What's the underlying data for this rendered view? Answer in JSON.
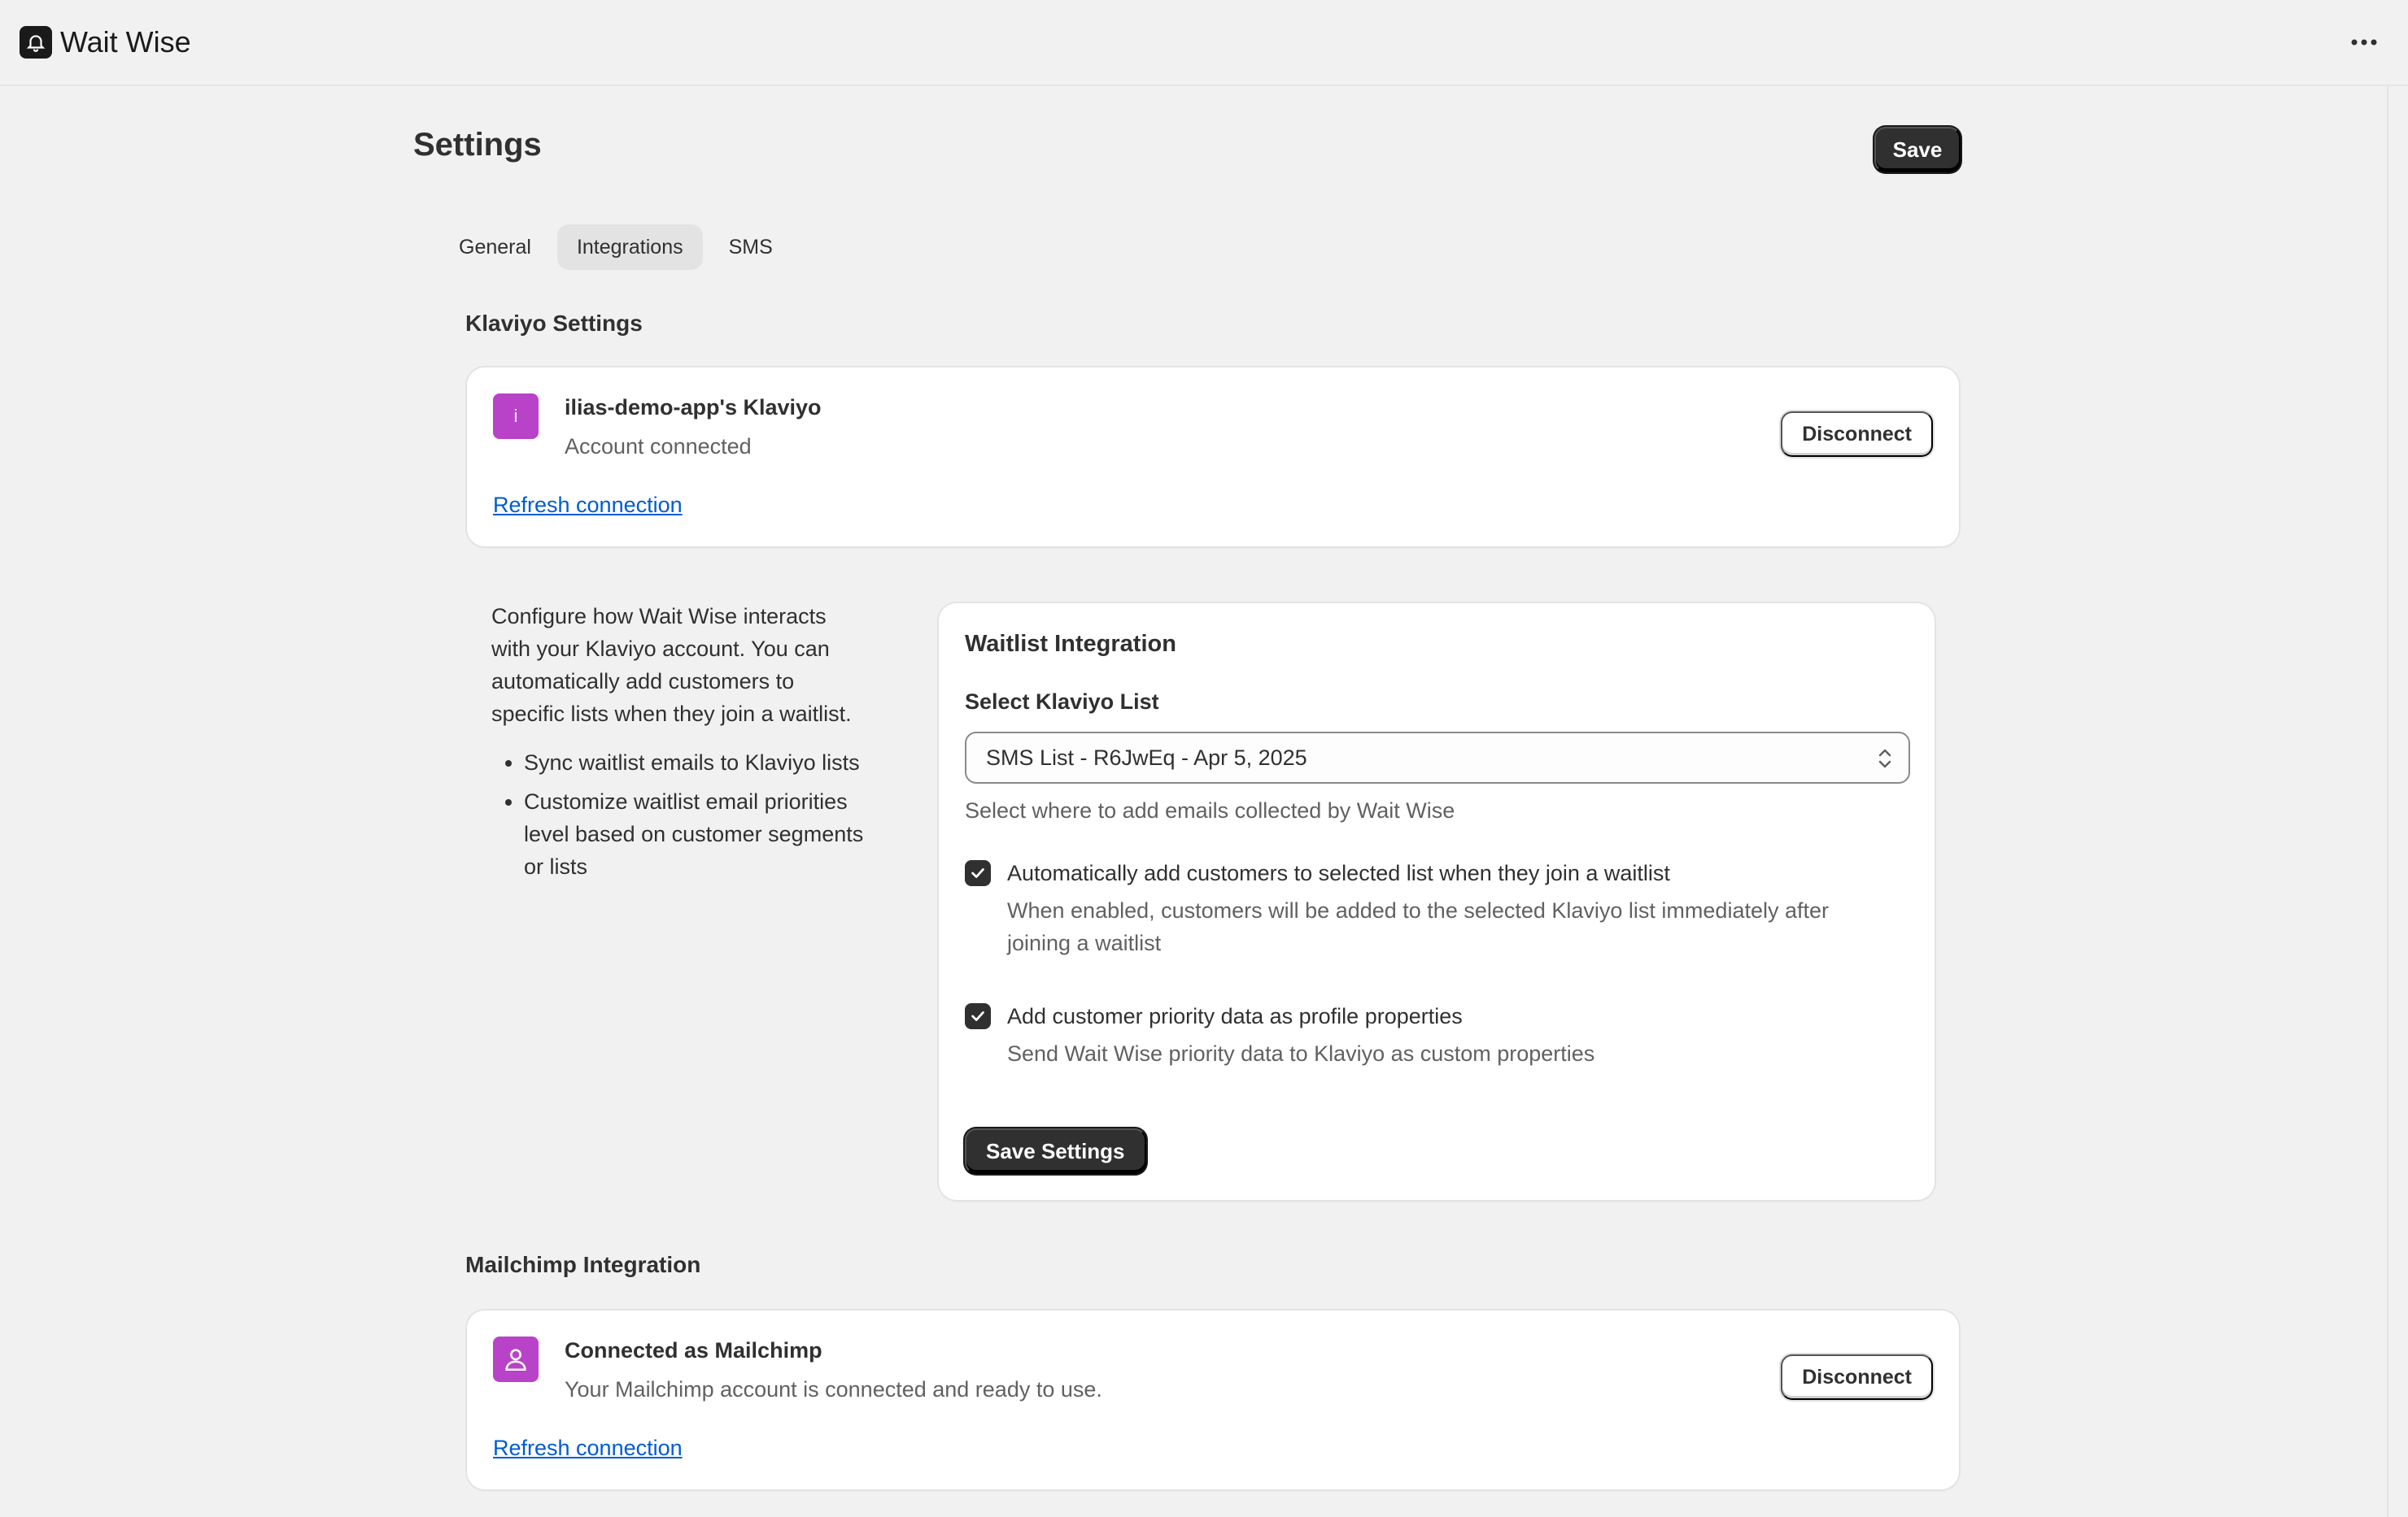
{
  "app": {
    "name": "Wait Wise",
    "logo_icon": "bell-icon",
    "menu_icon": "more-horizontal-icon"
  },
  "page": {
    "title": "Settings",
    "save_label": "Save"
  },
  "tabs": [
    {
      "label": "General",
      "active": false
    },
    {
      "label": "Integrations",
      "active": true
    },
    {
      "label": "SMS",
      "active": false
    }
  ],
  "klaviyo": {
    "section_title": "Klaviyo Settings",
    "avatar_letter": "i",
    "account_name": "ilias-demo-app's Klaviyo",
    "status": "Account connected",
    "disconnect_label": "Disconnect",
    "refresh_label": "Refresh connection"
  },
  "description": {
    "text": "Configure how Wait Wise interacts with your Klaviyo account. You can automatically add customers to specific lists when they join a waitlist.",
    "bullets": [
      "Sync waitlist emails to Klaviyo lists",
      "Customize waitlist email priorities level based on customer segments or lists"
    ]
  },
  "waitlist": {
    "title": "Waitlist Integration",
    "select_label": "Select Klaviyo List",
    "selected_value": "SMS List - R6JwEq - Apr 5, 2025",
    "select_help": "Select where to add emails collected by Wait Wise",
    "auto_add": {
      "checked": true,
      "label": "Automatically add customers to selected list when they join a waitlist",
      "help": "When enabled, customers will be added to the selected Klaviyo list immediately after joining a waitlist"
    },
    "priority": {
      "checked": true,
      "label": "Add customer priority data as profile properties",
      "help": "Send Wait Wise priority data to Klaviyo as custom properties"
    },
    "save_settings_label": "Save Settings"
  },
  "mailchimp": {
    "section_title": "Mailchimp Integration",
    "avatar_icon": "user-icon",
    "account_name": "Connected as Mailchimp",
    "status": "Your Mailchimp account is connected and ready to use.",
    "disconnect_label": "Disconnect",
    "refresh_label": "Refresh connection"
  },
  "colors": {
    "accent_avatar": "#b943c8",
    "primary_button": "#303030",
    "link": "#005bd3",
    "background": "#f1f1f1"
  }
}
